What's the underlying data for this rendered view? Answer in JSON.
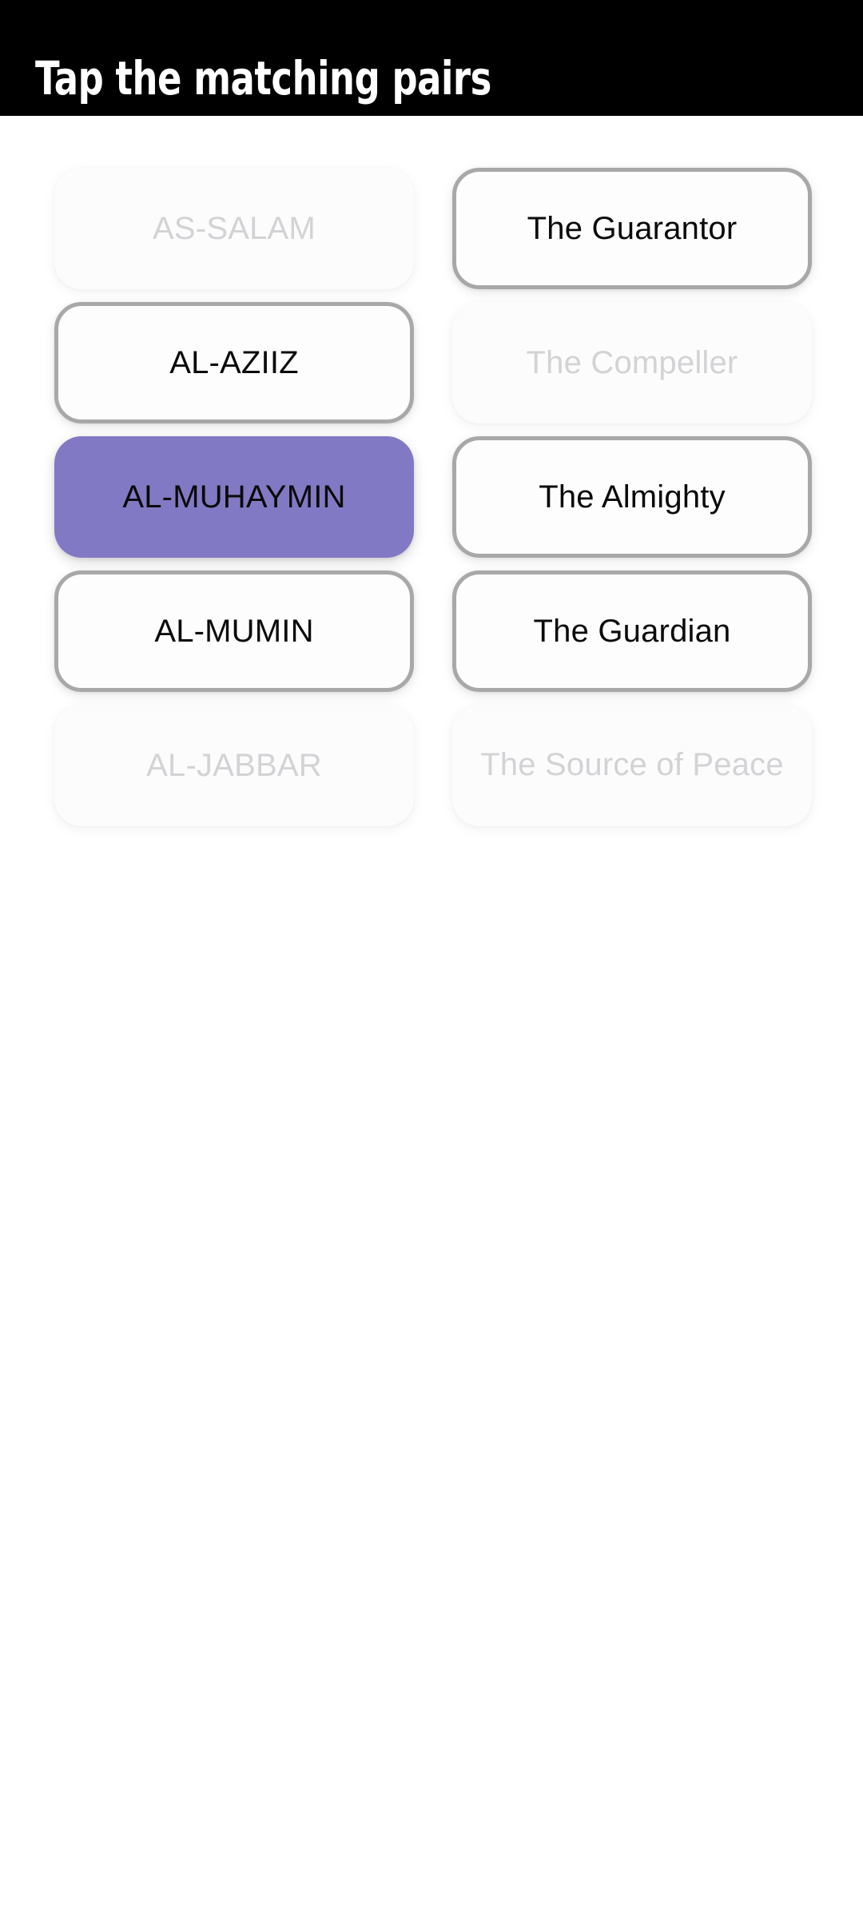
{
  "header": {
    "title": "Tap the matching pairs",
    "background_color": "#000000",
    "text_color": "#ffffff"
  },
  "theme": {
    "page_background": "#ffffff",
    "selected_card_color": "#8279c4",
    "default_card_border": "#a8a8a8",
    "default_card_background": "#fdfdfd",
    "default_text_color": "#0a0a0a",
    "matched_text_color": "#d3d3d6",
    "matched_card_background": "#fcfcfd"
  },
  "board": {
    "columns": [
      "arabic",
      "english"
    ],
    "rows": [
      {
        "left": {
          "label": "AS-SALAM",
          "state": "matched"
        },
        "right": {
          "label": "The Guarantor",
          "state": "default"
        }
      },
      {
        "left": {
          "label": "AL-AZIIZ",
          "state": "default"
        },
        "right": {
          "label": "The Compeller",
          "state": "matched"
        }
      },
      {
        "left": {
          "label": "AL-MUHAYMIN",
          "state": "selected"
        },
        "right": {
          "label": "The Almighty",
          "state": "default"
        }
      },
      {
        "left": {
          "label": "AL-MUMIN",
          "state": "default"
        },
        "right": {
          "label": "The Guardian",
          "state": "default"
        }
      },
      {
        "left": {
          "label": "AL-JABBAR",
          "state": "matched"
        },
        "right": {
          "label": "The Source of Peace",
          "state": "matched"
        }
      }
    ]
  }
}
